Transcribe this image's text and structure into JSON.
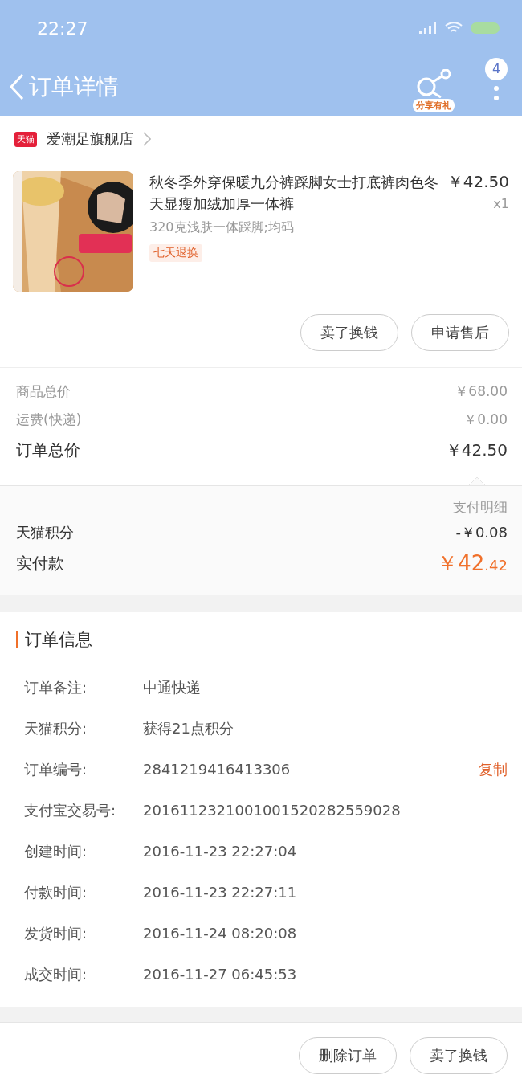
{
  "status_bar": {
    "time": "22:27"
  },
  "nav": {
    "title": "订单详情",
    "share_label": "分享有礼",
    "more_badge": "4"
  },
  "store": {
    "badge": "天猫",
    "name": "爱潮足旗舰店"
  },
  "product": {
    "kind": "picture",
    "title": "秋冬季外穿保暖九分裤踩脚女士打底裤肉色冬天显瘦加绒加厚一体裤",
    "price": "￥42.50",
    "quantity": "x1",
    "sku": "320克浅肤一体踩脚;均码",
    "tag": "七天退换"
  },
  "item_actions": [
    "卖了换钱",
    "申请售后"
  ],
  "summary": [
    {
      "label": "商品总价",
      "value": "￥68.00",
      "emphasis": false
    },
    {
      "label": "运费(快递)",
      "value": "￥0.00",
      "emphasis": false
    },
    {
      "label": "订单总价",
      "value": "￥42.50",
      "emphasis": true
    }
  ],
  "payment": {
    "title": "支付明细",
    "discount_label": "天猫积分",
    "discount_value": "-￥0.08",
    "paid_label": "实付款",
    "paid_main": "￥42",
    "paid_decimal": ".42"
  },
  "order_info": {
    "title": "订单信息",
    "rows": [
      {
        "label": "订单备注:",
        "value": "中通快递"
      },
      {
        "label": "天猫积分:",
        "value": "获得21点积分"
      },
      {
        "label": "订单编号:",
        "value": "2841219416413306",
        "action": "复制"
      },
      {
        "label": "支付宝交易号:",
        "value": "2016112321001001520282559028"
      },
      {
        "label": "创建时间:",
        "value": "2016-11-23 22:27:04"
      },
      {
        "label": "付款时间:",
        "value": "2016-11-23 22:27:11"
      },
      {
        "label": "发货时间:",
        "value": "2016-11-24 08:20:08"
      },
      {
        "label": "成交时间:",
        "value": "2016-11-27 06:45:53"
      }
    ]
  },
  "bottom_actions": [
    "删除订单",
    "卖了换钱"
  ]
}
